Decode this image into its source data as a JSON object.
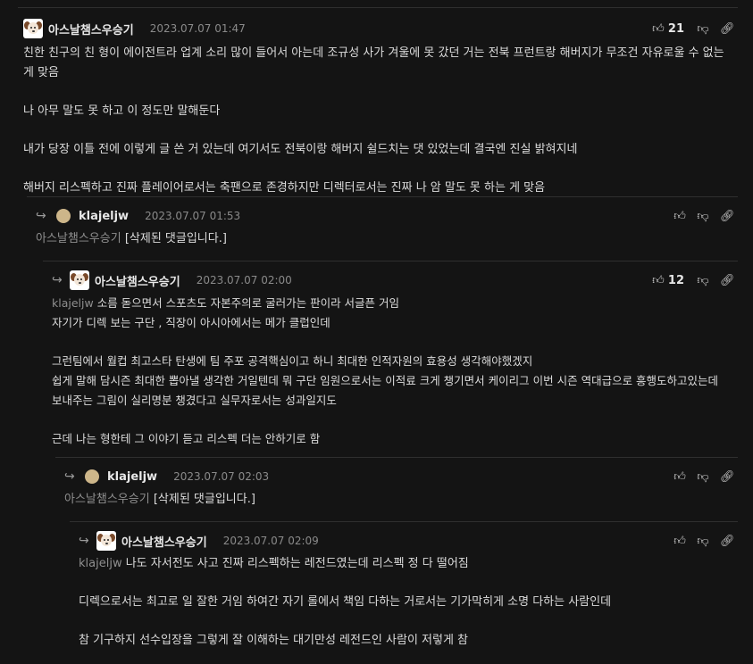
{
  "comments": [
    {
      "author": "아스날챔스우승기",
      "date": "2023.07.07 01:47",
      "likes": "21",
      "paragraphs": [
        "친한 친구의 친 형이 에이전트라 업계 소리 많이 들어서 아는데 조규성 사가 겨울에 못 갔던 거는 전북 프런트랑 해버지가 무조건 자유로울 수 없는 게 맞음",
        "나 아무 말도 못 하고 이 정도만 말해둔다",
        "내가 당장 이틀 전에 이렇게 글 쓴 거 있는데 여기서도 전북이랑 해버지 쉴드치는 댓 있었는데 결국엔 진실 밝혀지네",
        "해버지 리스펙하고 진짜 플레이어로서는 축팬으로 존경하지만 디렉터로서는 진짜 나 암 말도 못 하는 게 맞음"
      ]
    },
    {
      "author": "klajeljw",
      "date": "2023.07.07 01:53",
      "mention": "아스날챔스우승기",
      "text": "[삭제된 댓글입니다.]"
    },
    {
      "author": "아스날챔스우승기",
      "date": "2023.07.07 02:00",
      "likes": "12",
      "mention": "klajeljw",
      "line1": "소름 돋으면서 스포츠도 자본주의로 굴러가는 판이라 서글픈 거임",
      "paragraphs": [
        "자기가 디렉 보는 구단 , 직장이 아시아에서는 메가 클럽인데",
        "그런팀에서 월컵 최고스타 탄생에 팀 주포 공격핵심이고 하니 최대한 인적자원의 효용성 생각해야했겠지\n쉽게 말해 담시즌 최대한 뽑아낼 생각한 거일텐데 뭐 구단 임원으로서는 이적료 크게 챙기면서 케이리그 이번 시즌 역대급으로 흥행도하고있는데 보내주는 그림이 실리명분 챙겼다고 실무자로서는 성과일지도",
        "근데 나는 형한테 그 이야기 듣고 리스펙 더는 안하기로 함"
      ]
    },
    {
      "author": "klajeljw",
      "date": "2023.07.07 02:03",
      "mention": "아스날챔스우승기",
      "text": "[삭제된 댓글입니다.]"
    },
    {
      "author": "아스날챔스우승기",
      "date": "2023.07.07 02:09",
      "mention": "klajeljw",
      "line1": "나도 자서전도 사고 진짜 리스펙하는 레전드였는데 리스펙 정 다 떨어짐",
      "paragraphs": [
        "디렉으로서는 최고로 일 잘한 거임 하여간 자기 롤에서 책임 다하는 거로서는 기가막히게 소명 다하는 사람인데",
        "참 기구하지 선수입장을 그렇게 잘 이해하는 대기만성 레전드인 사람이 저렇게 참"
      ]
    }
  ],
  "icons": {
    "like": "thumbs-up-icon",
    "dislike": "thumbs-down-icon",
    "link": "link-icon",
    "reply": "reply-arrow-icon"
  }
}
